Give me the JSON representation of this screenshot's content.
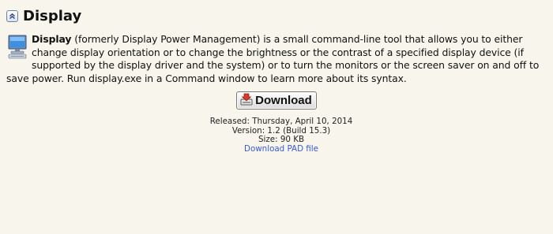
{
  "section": {
    "title": "Display"
  },
  "description": {
    "name": "Display",
    "text": " (formerly Display Power Management) is a small command-line tool that allows you to either change display orientation or to change the brightness or the contrast of a specified display device (if supported by the display driver and the system) or to turn the monitors or the screen saver on and off to save power. Run display.exe in a Command window to learn more about its syntax."
  },
  "download": {
    "label": "Download"
  },
  "info": {
    "released": "Released: Thursday, April 10, 2014",
    "version": "Version: 1.2 (Build 15.3)",
    "size": "Size: 90 KB",
    "pad_link": "Download PAD file"
  },
  "icons": {
    "collapse": "chevron-up-icon",
    "program": "computer-icon",
    "download": "download-icon"
  },
  "colors": {
    "background": "#f8f6ec",
    "link": "#3a5ad0"
  }
}
